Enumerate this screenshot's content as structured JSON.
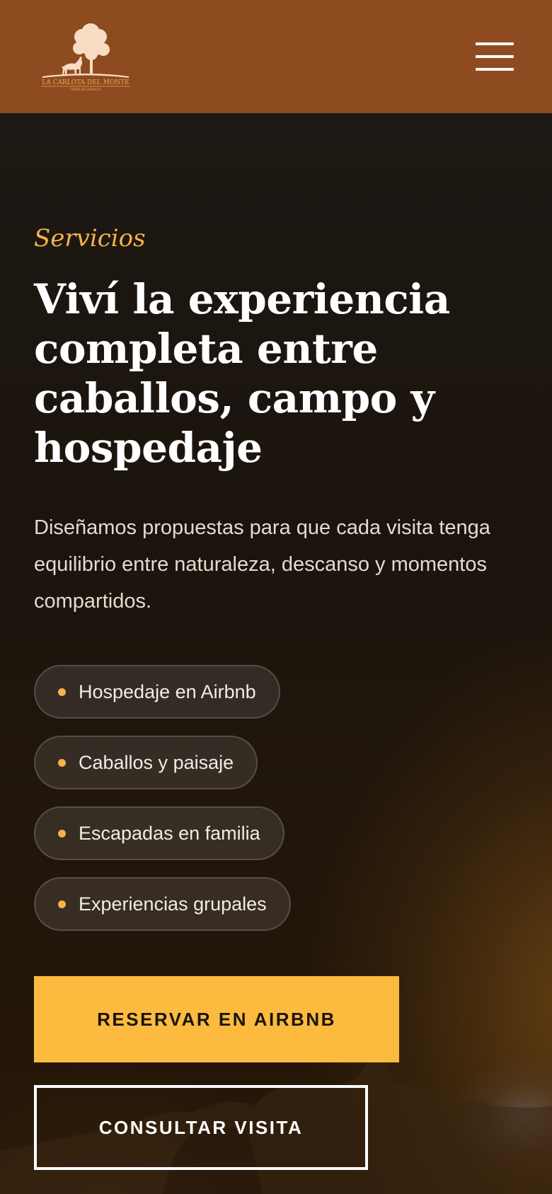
{
  "header": {
    "logo_text": "LA CARLOTA DEL MONTE",
    "logo_subtext": "TIERRA DE CABALLOS",
    "menu_icon": "hamburger-menu-icon"
  },
  "hero": {
    "eyebrow": "Servicios",
    "title": "Viví la experiencia completa entre caballos, campo y hospedaje",
    "description": "Diseñamos propuestas para que cada visita tenga equilibrio entre naturaleza, descanso y momentos compartidos.",
    "features": [
      {
        "label": "Hospedaje en Airbnb"
      },
      {
        "label": "Caballos y paisaje"
      },
      {
        "label": "Escapadas en familia"
      },
      {
        "label": "Experiencias grupales"
      }
    ],
    "primary_button": "RESERVAR EN AIRBNB",
    "secondary_button": "CONSULTAR VISITA"
  },
  "colors": {
    "header_bg": "#8e4b1f",
    "accent": "#f3b34a",
    "primary_button_bg": "#fcbb3f",
    "hero_bg": "#1b140d"
  }
}
